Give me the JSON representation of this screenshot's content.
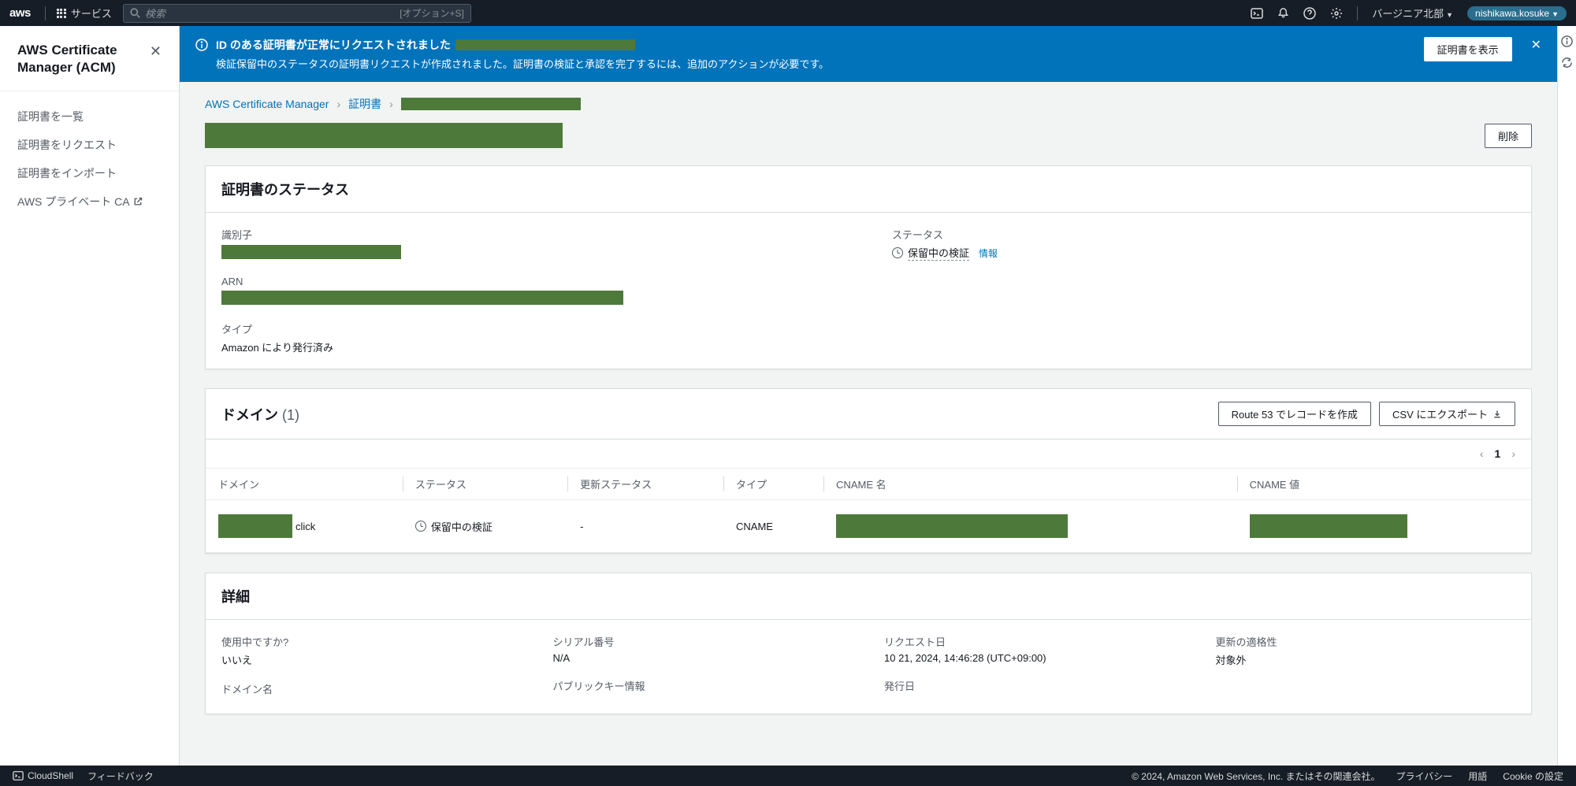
{
  "topbar": {
    "services_label": "サービス",
    "search_placeholder": "検索",
    "search_hint": "[オプション+S]",
    "region": "バージニア北部",
    "user": "nishikawa.kosuke"
  },
  "sidebar": {
    "title": "AWS Certificate Manager (ACM)",
    "items": [
      {
        "label": "証明書を一覧"
      },
      {
        "label": "証明書をリクエスト"
      },
      {
        "label": "証明書をインポート"
      },
      {
        "label": "AWS プライベート CA",
        "external": true
      }
    ]
  },
  "flash": {
    "title": "ID のある証明書が正常にリクエストされました",
    "desc": "検証保留中のステータスの証明書リクエストが作成されました。証明書の検証と承認を完了するには、追加のアクションが必要です。",
    "button": "証明書を表示"
  },
  "breadcrumb": {
    "root": "AWS Certificate Manager",
    "mid": "証明書"
  },
  "header": {
    "delete_btn": "削除"
  },
  "status_card": {
    "title": "証明書のステータス",
    "identifier_label": "識別子",
    "arn_label": "ARN",
    "type_label": "タイプ",
    "type_value": "Amazon により発行済み",
    "status_label": "ステータス",
    "status_value": "保留中の検証",
    "info_link": "情報"
  },
  "domains_card": {
    "title": "ドメイン",
    "count": "(1)",
    "route53_btn": "Route 53 でレコードを作成",
    "csv_btn": "CSV にエクスポート",
    "page": "1",
    "cols": {
      "domain": "ドメイン",
      "status": "ステータス",
      "renewal": "更新ステータス",
      "type": "タイプ",
      "cname_name": "CNAME 名",
      "cname_value": "CNAME 値"
    },
    "row": {
      "domain_suffix": "click",
      "status": "保留中の検証",
      "renewal": "-",
      "type": "CNAME"
    }
  },
  "details_card": {
    "title": "詳細",
    "in_use_label": "使用中ですか?",
    "in_use_value": "いいえ",
    "domain_label": "ドメイン名",
    "serial_label": "シリアル番号",
    "serial_value": "N/A",
    "pubkey_label": "パブリックキー情報",
    "requested_label": "リクエスト日",
    "requested_value": "10 21, 2024, 14:46:28 (UTC+09:00)",
    "issued_label": "発行日",
    "renewal_elig_label": "更新の適格性",
    "renewal_elig_value": "対象外"
  },
  "footer": {
    "cloudshell": "CloudShell",
    "feedback": "フィードバック",
    "copyright": "© 2024, Amazon Web Services, Inc. またはその関連会社。",
    "privacy": "プライバシー",
    "terms": "用語",
    "cookie": "Cookie の設定"
  }
}
